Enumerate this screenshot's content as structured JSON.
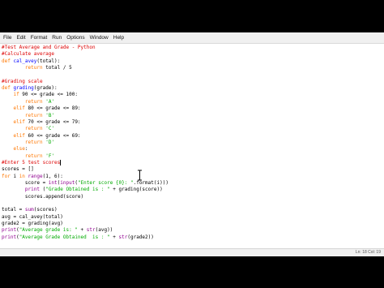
{
  "menu": [
    "File",
    "Edit",
    "Format",
    "Run",
    "Options",
    "Window",
    "Help"
  ],
  "colors": {
    "comment": "#dd0000",
    "keyword": "#ff7700",
    "builtin": "#900090",
    "string": "#00aa00",
    "definition": "#0000ff",
    "default": "#000000"
  },
  "code": [
    [
      [
        "comment",
        "#Test Average and Grade - Python"
      ]
    ],
    [
      [
        "comment",
        "#Calculate average"
      ]
    ],
    [
      [
        "keyword",
        "def "
      ],
      [
        "definition",
        "cal_avey"
      ],
      [
        "default",
        "(total):"
      ]
    ],
    [
      [
        "default",
        "        "
      ],
      [
        "keyword",
        "return"
      ],
      [
        "default",
        " total / 5"
      ]
    ],
    [
      [
        "default",
        ""
      ]
    ],
    [
      [
        "comment",
        "#Grading scale"
      ]
    ],
    [
      [
        "keyword",
        "def "
      ],
      [
        "definition",
        "grading"
      ],
      [
        "default",
        "(grade):"
      ]
    ],
    [
      [
        "default",
        "    "
      ],
      [
        "keyword",
        "if"
      ],
      [
        "default",
        " 90 <= grade <= 100:"
      ]
    ],
    [
      [
        "default",
        "        "
      ],
      [
        "keyword",
        "return"
      ],
      [
        "default",
        " "
      ],
      [
        "string",
        "'A'"
      ]
    ],
    [
      [
        "default",
        "    "
      ],
      [
        "keyword",
        "elif"
      ],
      [
        "default",
        " 80 <= grade <= 89:"
      ]
    ],
    [
      [
        "default",
        "        "
      ],
      [
        "keyword",
        "return"
      ],
      [
        "default",
        " "
      ],
      [
        "string",
        "'B'"
      ]
    ],
    [
      [
        "default",
        "    "
      ],
      [
        "keyword",
        "elif"
      ],
      [
        "default",
        " 70 <= grade <= 79:"
      ]
    ],
    [
      [
        "default",
        "        "
      ],
      [
        "keyword",
        "return"
      ],
      [
        "default",
        " "
      ],
      [
        "string",
        "'C'"
      ]
    ],
    [
      [
        "default",
        "    "
      ],
      [
        "keyword",
        "elif"
      ],
      [
        "default",
        " 60 <= grade <= 69:"
      ]
    ],
    [
      [
        "default",
        "        "
      ],
      [
        "keyword",
        "return"
      ],
      [
        "default",
        " "
      ],
      [
        "string",
        "'D'"
      ]
    ],
    [
      [
        "default",
        "    "
      ],
      [
        "keyword",
        "else"
      ],
      [
        "default",
        ":"
      ]
    ],
    [
      [
        "default",
        "        "
      ],
      [
        "keyword",
        "return"
      ],
      [
        "default",
        " "
      ],
      [
        "string",
        "'F'"
      ]
    ],
    [
      [
        "comment",
        "#Enter 5 test scores"
      ]
    ],
    [
      [
        "default",
        "scores = []"
      ]
    ],
    [
      [
        "keyword",
        "for"
      ],
      [
        "default",
        " i "
      ],
      [
        "keyword",
        "in"
      ],
      [
        "default",
        " "
      ],
      [
        "builtin",
        "range"
      ],
      [
        "default",
        "(1, 6):"
      ]
    ],
    [
      [
        "default",
        "        score = "
      ],
      [
        "builtin",
        "int"
      ],
      [
        "default",
        "("
      ],
      [
        "builtin",
        "input"
      ],
      [
        "default",
        "("
      ],
      [
        "string",
        "\"Enter score {0}: \""
      ],
      [
        "default",
        ".format(i)))"
      ]
    ],
    [
      [
        "default",
        "        "
      ],
      [
        "builtin",
        "print"
      ],
      [
        "default",
        " ("
      ],
      [
        "string",
        "\"Grade Obtained is : \""
      ],
      [
        "default",
        " + grading(score))"
      ]
    ],
    [
      [
        "default",
        "        scores.append(score)"
      ]
    ],
    [
      [
        "default",
        ""
      ]
    ],
    [
      [
        "default",
        "total = "
      ],
      [
        "builtin",
        "sum"
      ],
      [
        "default",
        "(scores)"
      ]
    ],
    [
      [
        "default",
        "avg = cal_avey(total)"
      ]
    ],
    [
      [
        "default",
        "grade2 = grading(avg)"
      ]
    ],
    [
      [
        "builtin",
        "print"
      ],
      [
        "default",
        "("
      ],
      [
        "string",
        "\"Average grade is: \""
      ],
      [
        "default",
        " + "
      ],
      [
        "builtin",
        "str"
      ],
      [
        "default",
        "(avg))"
      ]
    ],
    [
      [
        "builtin",
        "print"
      ],
      [
        "default",
        "("
      ],
      [
        "string",
        "\"Average Grade Obtained  is : \""
      ],
      [
        "default",
        " + "
      ],
      [
        "builtin",
        "str"
      ],
      [
        "default",
        "(grade2))"
      ]
    ]
  ],
  "status": "Ln: 18  Col: 19"
}
